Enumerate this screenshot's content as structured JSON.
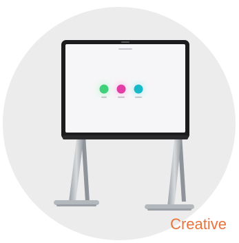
{
  "caption": {
    "label": "Creative",
    "color": "#e8743b"
  },
  "device": {
    "icon": "interactive-display-on-stand-icon",
    "screen_apps": [
      {
        "name": "green-app-icon",
        "color": "#3fd07a"
      },
      {
        "name": "magenta-app-icon",
        "color": "#e23ea6"
      },
      {
        "name": "teal-app-icon",
        "color": "#19b9c9"
      }
    ]
  },
  "colors": {
    "backdrop": "#ececec",
    "bezel": "#1c1c1e",
    "stand": "#a9aeb3"
  }
}
